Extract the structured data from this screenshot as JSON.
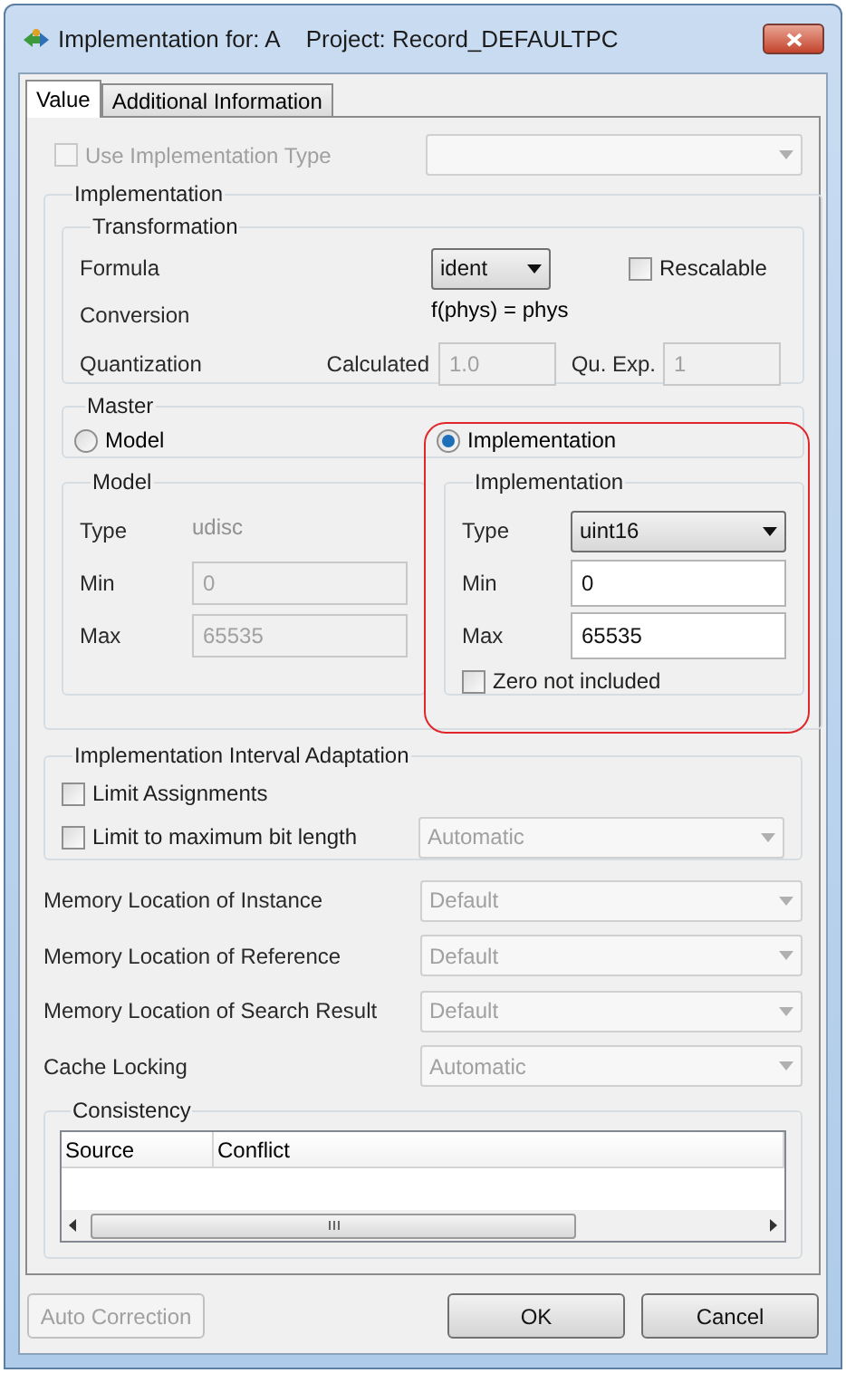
{
  "window": {
    "title": "Implementation for: A",
    "project": "Project: Record_DEFAULTPC"
  },
  "tabs": [
    {
      "label": "Value",
      "selected": true
    },
    {
      "label": "Additional Information",
      "selected": false
    }
  ],
  "use_implementation_type": {
    "label": "Use Implementation Type",
    "checked": false,
    "disabled": true
  },
  "implementation": {
    "title": "Implementation",
    "transformation": {
      "title": "Transformation",
      "formula_label": "Formula",
      "formula_value": "ident",
      "rescalable": {
        "label": "Rescalable",
        "checked": false
      },
      "conversion_label": "Conversion",
      "conversion_value": "f(phys) = phys",
      "quantization_label": "Quantization",
      "calculated_label": "Calculated",
      "calculated_value": "1.0",
      "exp_label": "Qu. Exp.",
      "exp_value": "1"
    },
    "master": {
      "title": "Master",
      "highlight_outline": true,
      "options": [
        {
          "label": "Model",
          "selected": false
        },
        {
          "label": "Implementation",
          "selected": true
        }
      ]
    },
    "model": {
      "title": "Model",
      "type_label": "Type",
      "type_value": "udisc",
      "min_label": "Min",
      "min_value": "0",
      "max_label": "Max",
      "max_value": "65535",
      "disabled": true
    },
    "detail": {
      "title": "Implementation",
      "type_label": "Type",
      "type_value": "uint16",
      "min_label": "Min",
      "min_value": "0",
      "max_label": "Max",
      "max_value": "65535",
      "zero_not_included": {
        "label": "Zero not included",
        "checked": false
      }
    }
  },
  "interval_adaptation": {
    "title": "Implementation Interval Adaptation",
    "limit_assignments": {
      "label": "Limit Assignments",
      "checked": false
    },
    "limit_bit_length": {
      "label": "Limit to maximum bit length",
      "checked": false,
      "value": "Automatic"
    }
  },
  "settings": [
    {
      "label": "Memory Location of Instance",
      "value": "Default",
      "disabled": true
    },
    {
      "label": "Memory Location of Reference",
      "value": "Default",
      "disabled": true
    },
    {
      "label": "Memory Location of Search Result",
      "value": "Default",
      "disabled": true
    },
    {
      "label": "Cache Locking",
      "value": "Automatic",
      "disabled": true
    }
  ],
  "consistency": {
    "title": "Consistency",
    "columns": [
      "Source",
      "Conflict"
    ]
  },
  "buttons": [
    {
      "label": "Auto Correction",
      "disabled": true
    },
    {
      "label": "OK",
      "disabled": false
    },
    {
      "label": "Cancel",
      "disabled": false
    }
  ]
}
